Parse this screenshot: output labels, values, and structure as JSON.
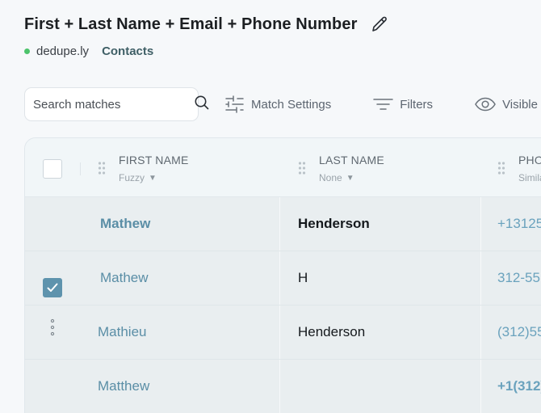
{
  "header": {
    "title": "First + Last Name + Email + Phone Number",
    "workspace": "dedupe.ly",
    "breadcrumb": "Contacts",
    "status_color": "#4cc36b"
  },
  "toolbar": {
    "search_placeholder": "Search matches",
    "match_settings": "Match Settings",
    "filters": "Filters",
    "visible": "Visible"
  },
  "columns": [
    {
      "title": "FIRST NAME",
      "match": "Fuzzy"
    },
    {
      "title": "LAST NAME",
      "match": "None"
    },
    {
      "title": "PHONE",
      "match": "Similar"
    }
  ],
  "rows": [
    {
      "first": "Mathew",
      "last": "Henderson",
      "phone": "+13125",
      "selected": false,
      "master": true
    },
    {
      "first": "Mathew",
      "last": "H",
      "phone": "312-55",
      "selected": true,
      "master": false
    },
    {
      "first": "Mathieu",
      "last": "Henderson",
      "phone": "(312)55",
      "selected": false,
      "master": false
    },
    {
      "first": "Matthew",
      "last": "",
      "phone": "+1(312)",
      "selected": false,
      "master": false
    }
  ],
  "colors": {
    "accent": "#5e93ad",
    "link": "#5a8ea6"
  }
}
